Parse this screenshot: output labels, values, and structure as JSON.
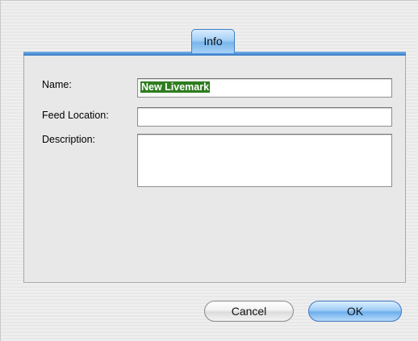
{
  "tabs": [
    {
      "label": "Info",
      "selected": true
    }
  ],
  "form": {
    "name_label": "Name:",
    "name_value": "New Livemark",
    "feed_label": "Feed Location:",
    "feed_value": "",
    "description_label": "Description:",
    "description_value": ""
  },
  "buttons": {
    "cancel_label": "Cancel",
    "ok_label": "OK"
  },
  "colors": {
    "accent": "#4b8fd6",
    "selection": "#2e7d1f"
  }
}
